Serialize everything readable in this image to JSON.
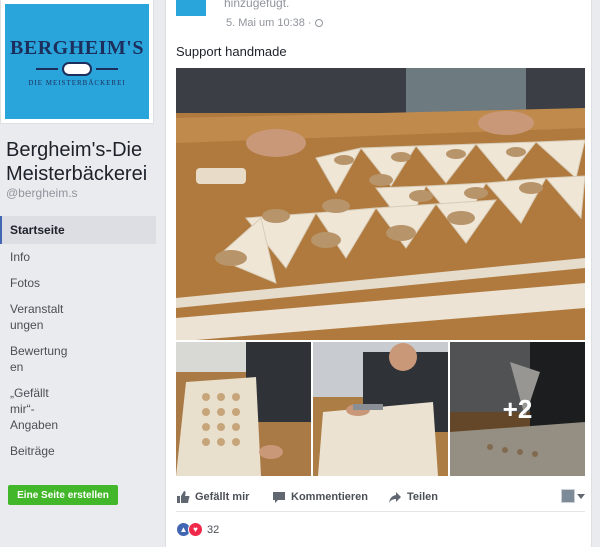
{
  "page": {
    "logo_text": "BERGHEIM'S",
    "logo_sub": "DIE MEISTERBÄCKEREI",
    "name": "Bergheim's-Die Meisterbäckerei",
    "handle": "@bergheim.s"
  },
  "nav": {
    "items": [
      {
        "label": "Startseite"
      },
      {
        "label": "Info"
      },
      {
        "label": "Fotos"
      },
      {
        "label": "Veranstaltungen"
      },
      {
        "label": "Bewertungen"
      },
      {
        "label": "„Gefällt mir“-Angaben"
      },
      {
        "label": "Beiträge"
      }
    ],
    "create_button": "Eine Seite erstellen"
  },
  "post": {
    "added_text": "hinzugefügt.",
    "timestamp": "5. Mai um 10:38 ·",
    "text": "Support handmade",
    "more_photos": "+2",
    "actions": {
      "like": "Gefällt mir",
      "comment": "Kommentieren",
      "share": "Teilen"
    },
    "reaction_count": "32"
  },
  "colors": {
    "facebook_blue": "#4267b2",
    "logo_bg": "#2aa5dc",
    "create_green": "#42b72a",
    "love_red": "#f0284a"
  }
}
